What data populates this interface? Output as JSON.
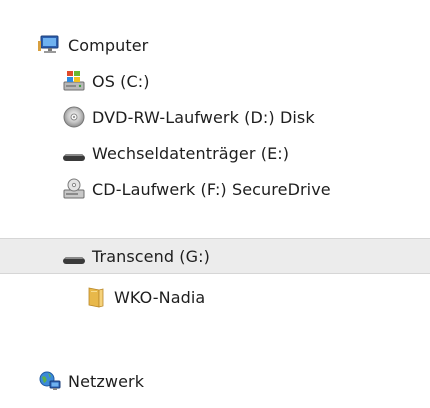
{
  "tree": {
    "computer": {
      "label": "Computer",
      "icon": "computer-icon"
    },
    "drives": [
      {
        "label": "OS (C:)",
        "icon": "os-drive-icon"
      },
      {
        "label": "DVD-RW-Laufwerk (D:) Disk",
        "icon": "dvd-disc-icon"
      },
      {
        "label": "Wechseldatenträger (E:)",
        "icon": "removable-drive-icon"
      },
      {
        "label": "CD-Laufwerk (F:) SecureDrive",
        "icon": "cd-drive-icon"
      },
      {
        "label": "Transcend (G:)",
        "icon": "removable-drive-icon"
      }
    ],
    "folder": {
      "label": "WKO-Nadia",
      "icon": "folder-icon"
    },
    "network": {
      "label": "Netzwerk",
      "icon": "network-icon"
    }
  },
  "colors": {
    "selected_row_bg": "#ececec",
    "selected_row_border": "#d6d6d6",
    "text": "#1e1e1e"
  }
}
